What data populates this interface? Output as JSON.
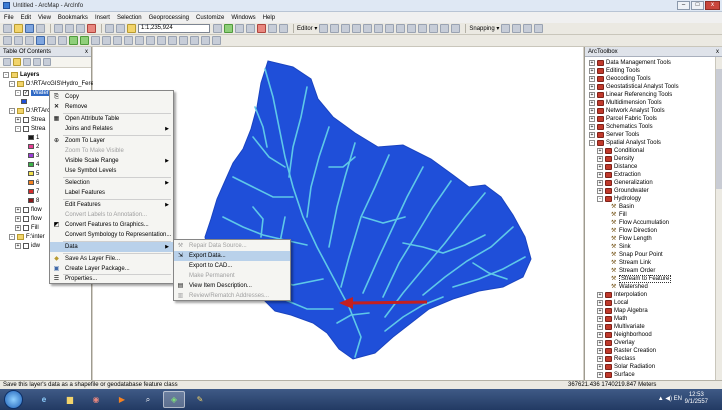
{
  "window": {
    "title": "Untitled - ArcMap - ArcInfo",
    "controls": {
      "minimize": "–",
      "maximize": "□",
      "close": "x"
    }
  },
  "menu": [
    "File",
    "Edit",
    "View",
    "Bookmarks",
    "Insert",
    "Selection",
    "Geoprocessing",
    "Customize",
    "Windows",
    "Help"
  ],
  "toolbar": {
    "scale": "1:1,235,924",
    "editor_label": "Editor ▾",
    "snapping_label": "Snapping ▾"
  },
  "toc": {
    "title": "Table Of Contents",
    "close": "x",
    "root": "Layers",
    "groups": [
      {
        "label": "D:\\RTArcGIS\\Hydro_Feret"
      },
      {
        "label": "Watershed"
      },
      {
        "label": "D:\\RTArcGIS"
      },
      {
        "label": "Strea"
      },
      {
        "label": "Strea"
      },
      {
        "label": "flow"
      },
      {
        "label": "flow"
      },
      {
        "label": "Fill"
      },
      {
        "label": "F:\\inter"
      },
      {
        "label": "idw"
      }
    ],
    "legend_swatch_colors": [
      "#1a1a1a",
      "#e63d92",
      "#9c3cd6",
      "#3cb34a",
      "#f2e14b",
      "#f58220",
      "#d62b2b",
      "#8b1a1a"
    ],
    "legend_values": [
      "1",
      "2",
      "3",
      "4",
      "5",
      "6",
      "7",
      "8"
    ]
  },
  "context_menu": {
    "items": [
      {
        "label": "Copy",
        "icon": "copy-icon",
        "enabled": true
      },
      {
        "label": "Remove",
        "icon": "remove-icon",
        "enabled": true
      },
      {
        "label": "Open Attribute Table",
        "icon": "table-icon",
        "enabled": true
      },
      {
        "label": "Joins and Relates",
        "enabled": true,
        "submenu": true
      },
      {
        "label": "Zoom To Layer",
        "icon": "zoom-layer-icon",
        "enabled": true
      },
      {
        "label": "Zoom To Make Visible",
        "enabled": false
      },
      {
        "label": "Visible Scale Range",
        "enabled": true,
        "submenu": true
      },
      {
        "label": "Use Symbol Levels",
        "enabled": true
      },
      {
        "label": "Selection",
        "enabled": true,
        "submenu": true
      },
      {
        "label": "Label Features",
        "enabled": true
      },
      {
        "label": "Edit Features",
        "enabled": true,
        "submenu": true
      },
      {
        "label": "Convert Labels to Annotation...",
        "enabled": false
      },
      {
        "label": "Convert Features to Graphics...",
        "icon": "graphics-icon",
        "enabled": true
      },
      {
        "label": "Convert Symbology to Representation...",
        "enabled": true
      },
      {
        "label": "Data",
        "enabled": true,
        "submenu": true,
        "highlighted": true
      },
      {
        "label": "Save As Layer File...",
        "icon": "save-layer-icon",
        "enabled": true
      },
      {
        "label": "Create Layer Package...",
        "icon": "package-icon",
        "enabled": true
      },
      {
        "label": "Properties...",
        "icon": "properties-icon",
        "enabled": true
      }
    ]
  },
  "data_submenu": {
    "items": [
      {
        "label": "Repair Data Source...",
        "enabled": false
      },
      {
        "label": "Export Data...",
        "enabled": true,
        "highlighted": true
      },
      {
        "label": "Export to CAD...",
        "enabled": true
      },
      {
        "label": "Make Permanent",
        "enabled": false
      },
      {
        "label": "View Item Description...",
        "enabled": true
      },
      {
        "label": "Review/Rematch Addresses...",
        "enabled": false
      }
    ]
  },
  "toolbox": {
    "title": "ArcToolbox",
    "close": "x",
    "top_items": [
      "Data Management Tools",
      "Editing Tools",
      "Geocoding Tools",
      "Geostatistical Analyst Tools",
      "Linear Referencing Tools",
      "Multidimension Tools",
      "Network Analyst Tools",
      "Parcel Fabric Tools",
      "Schematics Tools",
      "Server Tools",
      "Spatial Analyst Tools"
    ],
    "spatial_items": [
      "Conditional",
      "Density",
      "Distance",
      "Extraction",
      "Generalization",
      "Groundwater",
      "Hydrology"
    ],
    "hydrology_tools": [
      "Basin",
      "Fill",
      "Flow Accumulation",
      "Flow Direction",
      "Flow Length",
      "Sink",
      "Snap Pour Point",
      "Stream Link",
      "Stream Order",
      "Stream to Feature",
      "Watershed"
    ],
    "selected_tool": "Stream to Feature",
    "bottom_items": [
      "Interpolation",
      "Local",
      "Map Algebra",
      "Math",
      "Multivariate",
      "Neighborhood",
      "Overlay",
      "Raster Creation",
      "Reclass",
      "Solar Radiation",
      "Surface"
    ]
  },
  "map": {
    "watershed_color": "#1f4fd9",
    "stream_color": "#5ec8e8",
    "arrow_color": "#c42020"
  },
  "status": {
    "message": "Save this layer's data as a shapefile or geodatabase feature class",
    "coordinates": "367621.436  1740219.847 Meters"
  },
  "taskbar": {
    "time": "12:53",
    "date": "9/1/2557",
    "tray": "▲ ◀) EN"
  }
}
